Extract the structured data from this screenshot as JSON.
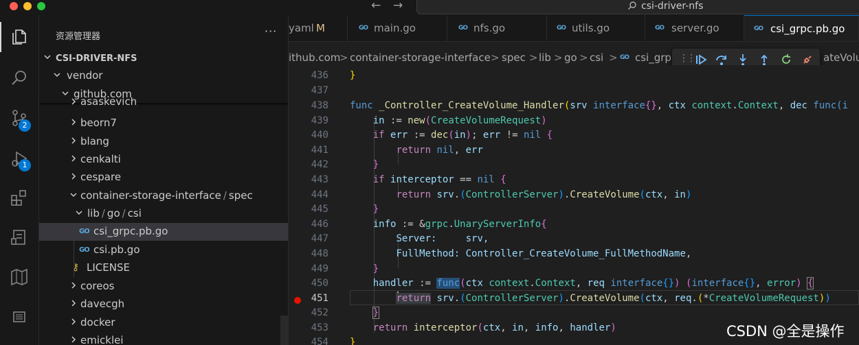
{
  "titlebar": {
    "command_center": "csi-driver-nfs",
    "back_arrow": "←",
    "forward_arrow": "→"
  },
  "activity_bar": {
    "items": [
      {
        "icon": "files-icon"
      },
      {
        "icon": "search-icon"
      },
      {
        "icon": "source-control-icon",
        "badge": "2"
      },
      {
        "icon": "run-debug-icon",
        "badge": "1"
      },
      {
        "icon": "extensions-icon"
      },
      {
        "icon": "remote-explorer-icon"
      },
      {
        "icon": "map-icon"
      },
      {
        "icon": "panel-icon"
      }
    ]
  },
  "sidebar": {
    "title": "资源管理器",
    "more": "···",
    "root": "CSI-DRIVER-NFS",
    "tree": [
      {
        "label": "vendor",
        "expanded": true
      },
      {
        "label": "github.com",
        "expanded": true
      },
      {
        "label": "asaskevich",
        "expanded": false
      },
      {
        "label": "beorn7",
        "expanded": false
      },
      {
        "label": "blang",
        "expanded": false
      },
      {
        "label": "cenkalti",
        "expanded": false
      },
      {
        "label": "cespare",
        "expanded": false
      },
      {
        "label_parts": [
          "container-storage-interface",
          "/",
          "spec"
        ],
        "expanded": true
      },
      {
        "label_parts": [
          "lib",
          "/",
          "go",
          "/",
          "csi"
        ],
        "expanded": true
      },
      {
        "label": "csi_grpc.pb.go",
        "file": true,
        "selected": true
      },
      {
        "label": "csi.pb.go",
        "file": true
      },
      {
        "label": "LICENSE",
        "file": true,
        "key": true
      },
      {
        "label": "coreos",
        "expanded": false
      },
      {
        "label": "davecgh",
        "expanded": false
      },
      {
        "label": "docker",
        "expanded": false
      },
      {
        "label": "emicklei",
        "expanded": false
      }
    ]
  },
  "tabs": [
    {
      "label": "yaml",
      "modified": "M"
    },
    {
      "label": "main.go"
    },
    {
      "label": "nfs.go"
    },
    {
      "label": "utils.go"
    },
    {
      "label": "server.go"
    },
    {
      "label": "csi_grpc.pb.go",
      "active": true
    }
  ],
  "go_icon": "GO",
  "breadcrumb": {
    "parts": [
      "ithub.com",
      "container-storage-interface",
      "spec",
      "lib",
      "go",
      "csi",
      "csi_grp",
      "ateVolum"
    ],
    "separator": ">"
  },
  "debug_toolbar": {
    "grip": "⋮⋮",
    "actions": [
      "continue-icon",
      "step-over-icon",
      "step-into-icon",
      "step-out-icon",
      "restart-icon",
      "disconnect-icon"
    ]
  },
  "editor": {
    "current_line": "451",
    "lines": [
      {
        "n": "436"
      },
      {
        "n": "437"
      },
      {
        "n": "438"
      },
      {
        "n": "439"
      },
      {
        "n": "440"
      },
      {
        "n": "441"
      },
      {
        "n": "442"
      },
      {
        "n": "443"
      },
      {
        "n": "444"
      },
      {
        "n": "445"
      },
      {
        "n": "446"
      },
      {
        "n": "447"
      },
      {
        "n": "448"
      },
      {
        "n": "449"
      },
      {
        "n": "450"
      },
      {
        "n": "451"
      },
      {
        "n": "452"
      },
      {
        "n": "453"
      },
      {
        "n": "454"
      }
    ],
    "tokens": {
      "l436": "}",
      "l438_func": "func",
      "l438_name": "_Controller_CreateVolume_Handler",
      "l438_srv": "srv",
      "l438_iface": "interface",
      "l438_ctx": "ctx",
      "l438_pkg": "context",
      "l438_ctxtype": "Context",
      "l438_dec": "dec",
      "l438_func2": "func(i",
      "l439_in": "in",
      "l439_new": "new",
      "l439_type": "CreateVolumeRequest",
      "l440_if": "if",
      "l440_err": "err",
      "l440_dec": "dec",
      "l440_in": "in",
      "l440_nil": "nil",
      "l441_return": "return",
      "l441_nil": "nil",
      "l441_err": "err",
      "l443_if": "if",
      "l443_ic": "interceptor",
      "l443_nil": "nil",
      "l444_return": "return",
      "l444_srv": "srv",
      "l444_cs": "ControllerServer",
      "l444_cv": "CreateVolume",
      "l444_ctx": "ctx",
      "l444_in": "in",
      "l446_info": "info",
      "l446_grpc": "grpc",
      "l446_usi": "UnaryServerInfo",
      "l447_server": "Server:",
      "l447_srv": "srv,",
      "l448_fm": "FullMethod:",
      "l448_const": "Controller_CreateVolume_FullMethodName",
      "l450_handler": "handler",
      "l450_func": "func",
      "l450_ctx": "ctx",
      "l450_pkg": "context",
      "l450_ctxtype": "Context",
      "l450_req": "req",
      "l450_iface1": "interface",
      "l450_iface2": "interface",
      "l450_error": "error",
      "l451_return": "return",
      "l451_srv": "srv",
      "l451_cs": "ControllerServer",
      "l451_cv": "CreateVolume",
      "l451_ctx": "ctx",
      "l451_req": "req",
      "l451_type": "CreateVolumeRequest",
      "l453_return": "return",
      "l453_ic": "interceptor",
      "l453_ctx": "ctx",
      "l453_in": "in",
      "l453_info": "info",
      "l453_handler": "handler",
      "l454": "}"
    }
  },
  "watermark": "CSDN @全是操作",
  "colors": {
    "accent": "#0078d4",
    "breakpoint": "#e51400",
    "keyword": "#c586c0",
    "keyword_blue": "#569cd6",
    "function": "#dcdcaa",
    "type": "#4ec9b0",
    "variable": "#9cdcfe"
  }
}
